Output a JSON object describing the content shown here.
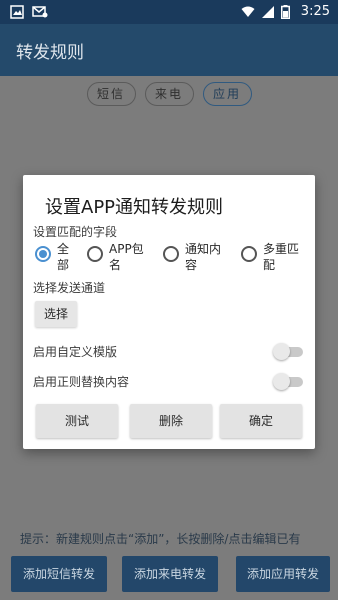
{
  "status_bar": {
    "time": "3:25"
  },
  "app_bar": {
    "title": "转发规则"
  },
  "tabs": [
    {
      "label": "短信",
      "active": false
    },
    {
      "label": "来电",
      "active": false
    },
    {
      "label": "应用",
      "active": true
    }
  ],
  "hint": "提示：新建规则点击“添加”，长按删除/点击编辑已有",
  "bottom_buttons": [
    "添加短信转发",
    "添加来电转发",
    "添加应用转发"
  ],
  "dialog": {
    "title": "设置APP通知转发规则",
    "match_field_label": "设置匹配的字段",
    "radio_options": [
      {
        "label": "全部",
        "checked": true
      },
      {
        "label": "APP包名",
        "checked": false
      },
      {
        "label": "通知内容",
        "checked": false
      },
      {
        "label": "多重匹配",
        "checked": false
      }
    ],
    "channel_label": "选择发送通道",
    "choose_button": "选择",
    "toggles": [
      {
        "label": "启用自定义模版",
        "on": false
      },
      {
        "label": "启用正则替换内容",
        "on": false
      }
    ],
    "buttons": {
      "test": "测试",
      "delete": "删除",
      "confirm": "确定"
    }
  },
  "colors": {
    "accent": "#4a90d0",
    "app_bar": "#244a6b",
    "status_bar": "#1a3a5c"
  }
}
